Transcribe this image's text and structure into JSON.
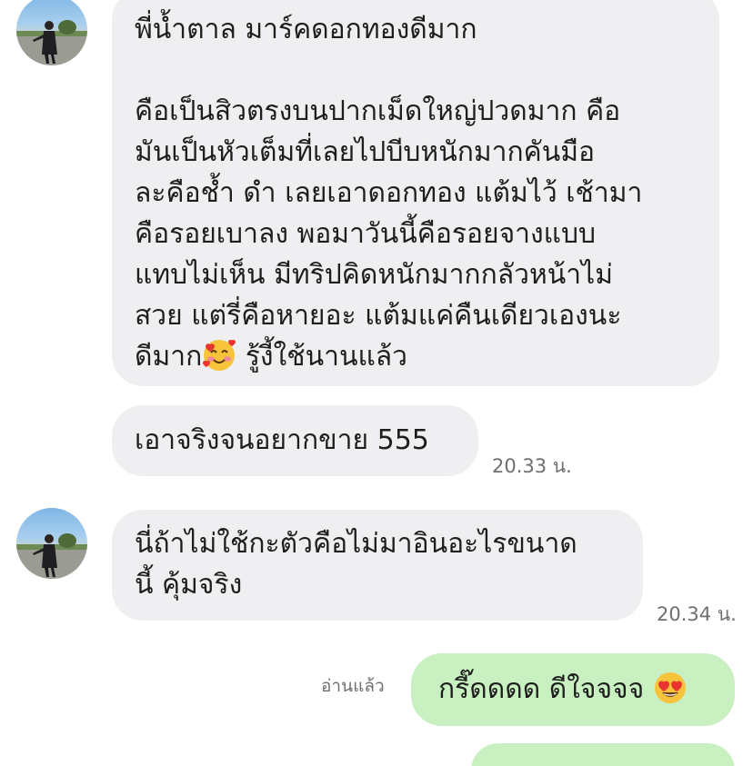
{
  "messages": [
    {
      "lines": [
        "พี่น้ำตาล มาร์คดอกทองดีมาก",
        "",
        "คือเป็นสิวตรงบนปากเม็ดใหญ่ปวดมาก คือ",
        "มันเป็นหัวเต็มที่เลยไปบีบหนักมากคันมือ",
        "ละคือช้ำ ดำ เลยเอาดอกทอง แต้มไว้ เช้ามา",
        "คือรอยเบาลง พอมาวันนี้คือรอยจางแบบ",
        "แทบไม่เห็น มีทริปคิดหนักมากกลัวหน้าไม่",
        "สวย แต่รี่คือหายอะ แต้มแค่คืนเดียวเองนะ"
      ],
      "last_line_before": "ดีมาก",
      "last_line_emoji": "smiling-face-with-hearts-emoji",
      "last_line_after": " รู้งี้ใช้นานแล้ว"
    },
    {
      "text": "เอาจริงจนอยากขาย 555",
      "time": "20.33 น."
    },
    {
      "lines": [
        "นี่ถ้าไม่ใช้กะตัวคือไม่มาอินอะไรขนาด",
        "นี้ คุ้มจริง"
      ],
      "time": "20.34 น."
    },
    {
      "text": "กรี๊ดดดด ดีใจจจจ",
      "emoji": "heart-eyes-emoji",
      "read_label": "อ่านแล้ว"
    }
  ],
  "colors": {
    "incoming_bubble": "#efeff1",
    "outgoing_bubble": "#c9f0c1",
    "text": "#1e1e1e",
    "meta": "#6f6f6f"
  }
}
